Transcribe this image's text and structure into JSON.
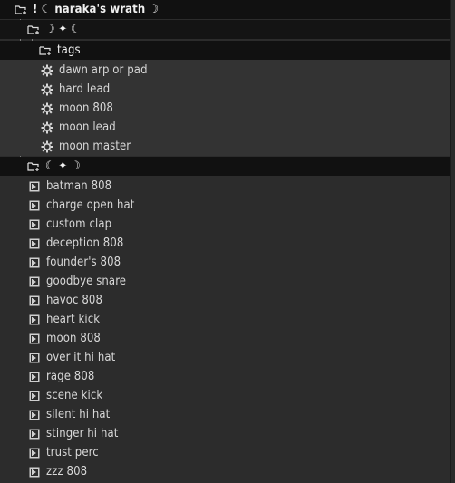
{
  "root_folder": {
    "label": "! ☾ naraka's wrath ☽"
  },
  "folder_a": {
    "label": "☽ ✦ ☾"
  },
  "tags_folder": {
    "label": "tags"
  },
  "presets": [
    {
      "label": "dawn arp or pad"
    },
    {
      "label": "hard lead"
    },
    {
      "label": "moon 808"
    },
    {
      "label": "moon lead"
    },
    {
      "label": "moon master"
    }
  ],
  "folder_b": {
    "label": "☾ ✦ ☽"
  },
  "samples": [
    {
      "label": "batman 808"
    },
    {
      "label": "charge open hat"
    },
    {
      "label": "custom clap"
    },
    {
      "label": "deception 808"
    },
    {
      "label": "founder's 808"
    },
    {
      "label": "goodbye snare"
    },
    {
      "label": "havoc 808"
    },
    {
      "label": "heart kick"
    },
    {
      "label": "moon 808"
    },
    {
      "label": "over it hi hat"
    },
    {
      "label": "rage 808"
    },
    {
      "label": "scene kick"
    },
    {
      "label": "silent hi hat"
    },
    {
      "label": "stinger hi hat"
    },
    {
      "label": "trust perc"
    },
    {
      "label": "zzz 808"
    }
  ]
}
